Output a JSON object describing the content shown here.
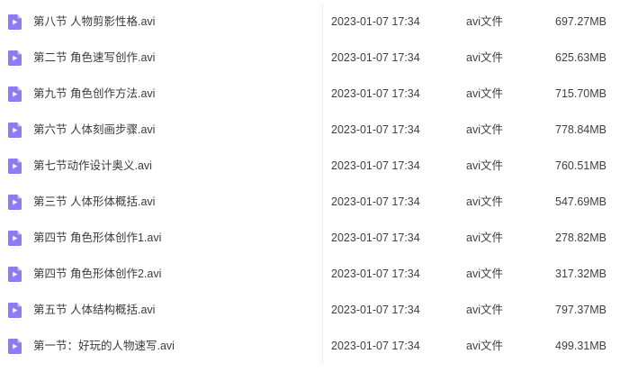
{
  "file_list": {
    "rows": [
      {
        "name": "第八节 人物剪影性格.avi",
        "modified": "2023-01-07 17:34",
        "type": "avi文件",
        "size": "697.27MB"
      },
      {
        "name": "第二节 角色速写创作.avi",
        "modified": "2023-01-07 17:34",
        "type": "avi文件",
        "size": "625.63MB"
      },
      {
        "name": "第九节 角色创作方法.avi",
        "modified": "2023-01-07 17:34",
        "type": "avi文件",
        "size": "715.70MB"
      },
      {
        "name": "第六节 人体刻画步骤.avi",
        "modified": "2023-01-07 17:34",
        "type": "avi文件",
        "size": "778.84MB"
      },
      {
        "name": "第七节动作设计奥义.avi",
        "modified": "2023-01-07 17:34",
        "type": "avi文件",
        "size": "760.51MB"
      },
      {
        "name": "第三节 人体形体概括.avi",
        "modified": "2023-01-07 17:34",
        "type": "avi文件",
        "size": "547.69MB"
      },
      {
        "name": "第四节 角色形体创作1.avi",
        "modified": "2023-01-07 17:34",
        "type": "avi文件",
        "size": "278.82MB"
      },
      {
        "name": "第四节 角色形体创作2.avi",
        "modified": "2023-01-07 17:34",
        "type": "avi文件",
        "size": "317.32MB"
      },
      {
        "name": "第五节 人体结构概括.avi",
        "modified": "2023-01-07 17:34",
        "type": "avi文件",
        "size": "797.37MB"
      },
      {
        "name": "第一节：好玩的人物速写.avi",
        "modified": "2023-01-07 17:34",
        "type": "avi文件",
        "size": "499.31MB"
      }
    ]
  },
  "icons": {
    "video_file": "video-file-icon"
  },
  "colors": {
    "icon_fill": "#8c7cf0",
    "icon_fold": "#c7bff9",
    "icon_play": "#ffffff",
    "text": "#404040",
    "divider": "#ececec"
  }
}
